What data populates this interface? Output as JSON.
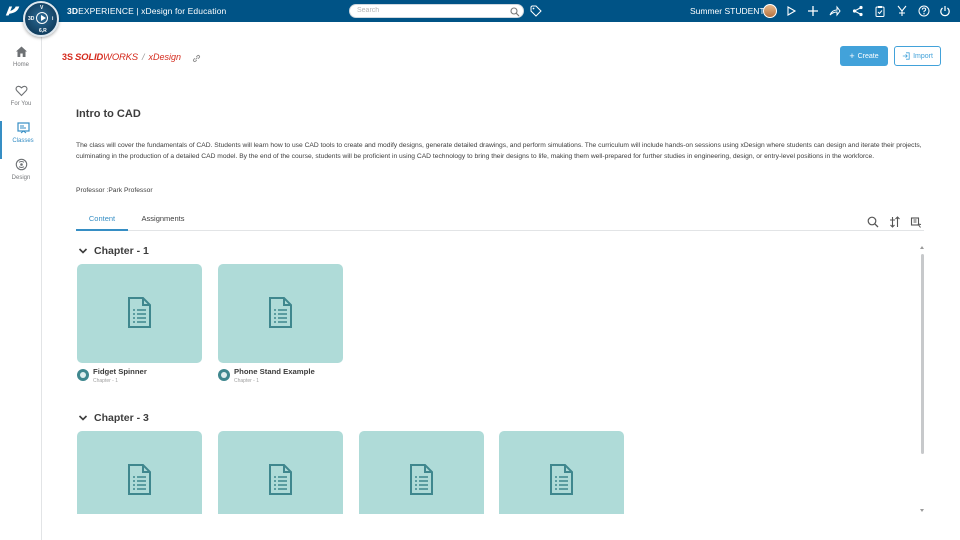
{
  "topbar": {
    "brand_bold": "3D",
    "brand_rest": "EXPERIENCE | xDesign for Education",
    "search_placeholder": "Search",
    "username": "Summer STUDENT",
    "compass_quadrants": [
      "3D",
      "V",
      "i",
      "6,R"
    ]
  },
  "leftnav": {
    "items": [
      {
        "label": "Home",
        "icon": "home-icon"
      },
      {
        "label": "For You",
        "icon": "heart-icon"
      },
      {
        "label": "Classes",
        "icon": "classes-icon",
        "active": true
      },
      {
        "label": "Design",
        "icon": "design-icon"
      }
    ]
  },
  "header": {
    "logo_prefix": "3S",
    "logo_brand_bold": "SOLID",
    "logo_brand_rest": "WORKS",
    "logo_separator": "/",
    "logo_product": "xDesign",
    "create_label": "Create",
    "import_label": "Import"
  },
  "course": {
    "title": "Intro to CAD",
    "description": "The class will cover the fundamentals of CAD. Students will learn how to use CAD tools to create and modify designs, generate detailed drawings, and perform simulations. The curriculum will include hands-on sessions using xDesign where students can design and iterate their projects, culminating in the production of a detailed CAD model. By the end of the course, students will be proficient in using CAD technology to bring their designs to life, making them well-prepared for further studies in engineering, design, or entry-level positions in the workforce.",
    "professor": "Professor :Park Professor"
  },
  "tabs": [
    {
      "label": "Content",
      "active": true
    },
    {
      "label": "Assignments",
      "active": false
    }
  ],
  "chapters": [
    {
      "title": "Chapter - 1",
      "items": [
        {
          "name": "Fidget Spinner",
          "sub": "Chapter - 1"
        },
        {
          "name": "Phone Stand Example",
          "sub": "Chapter - 1"
        }
      ]
    },
    {
      "title": "Chapter - 3",
      "items": [
        {
          "name": "",
          "sub": ""
        },
        {
          "name": "",
          "sub": ""
        },
        {
          "name": "",
          "sub": ""
        },
        {
          "name": "",
          "sub": ""
        }
      ]
    }
  ],
  "colors": {
    "topbar": "#005386",
    "accent": "#368ec4",
    "button": "#42a2da",
    "card_thumb": "#afdbd8",
    "doc_icon": "#3f878e",
    "brand_red": "#d52b1e"
  }
}
